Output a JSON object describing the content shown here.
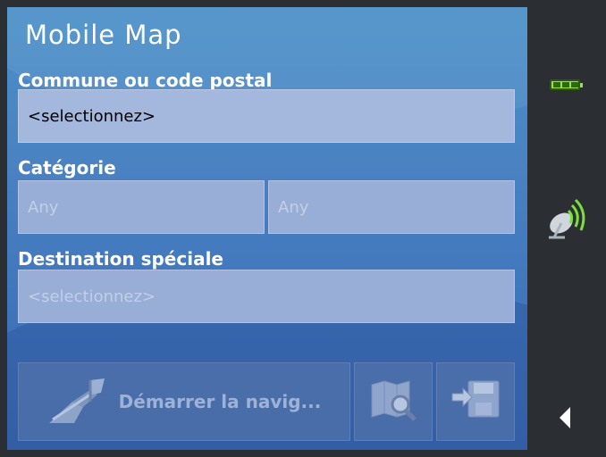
{
  "app": {
    "title": "Mobile Map"
  },
  "commune": {
    "label": "Commune ou code postal",
    "value": "<selectionnez>"
  },
  "categorie": {
    "label": "Catégorie",
    "values": [
      "Any",
      "Any"
    ]
  },
  "destination": {
    "label": "Destination spéciale",
    "value": "<selectionnez>"
  },
  "buttons": {
    "navigate_label": "Démarrer la navig..."
  },
  "sidebar": {
    "battery_icon": "battery-icon",
    "gps_icon": "satellite-dish-icon",
    "back_icon": "back-arrow-icon"
  },
  "colors": {
    "panel": "#4a86c4",
    "field": "#a3b6d9",
    "sidebar": "#2b2f33",
    "battery": "#9be23e"
  }
}
